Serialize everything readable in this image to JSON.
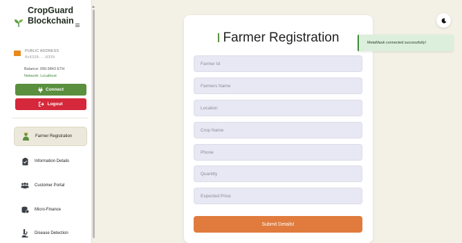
{
  "sidebar": {
    "brand": {
      "line1": "CropGuard",
      "line2": "Blockchain"
    },
    "account": {
      "address_label": "PUBLIC ADDRESS",
      "address_value": "0x6320...8339",
      "balance": "Balance: 999.9843 ETH",
      "network": "Network: Localhost"
    },
    "connect_label": "Connect",
    "logout_label": "Logout",
    "nav": [
      {
        "label": "Farmer Registration",
        "icon": "farmer-icon",
        "active": true
      },
      {
        "label": "Information Details",
        "icon": "clipboard-icon",
        "active": false
      },
      {
        "label": "Customer Portal",
        "icon": "users-icon",
        "active": false
      },
      {
        "label": "Micro-Finance",
        "icon": "coins-icon",
        "active": false
      },
      {
        "label": "Disease Detection",
        "icon": "microscope-icon",
        "active": false
      }
    ]
  },
  "form": {
    "title": "Farmer Registration",
    "fields": [
      {
        "placeholder": "Farmer Id",
        "value": ""
      },
      {
        "placeholder": "Farmers Name",
        "value": ""
      },
      {
        "placeholder": "Location",
        "value": ""
      },
      {
        "placeholder": "Crop Name",
        "value": ""
      },
      {
        "placeholder": "Phone",
        "value": ""
      },
      {
        "placeholder": "Quantity",
        "value": ""
      },
      {
        "placeholder": "Expected Price",
        "value": ""
      }
    ],
    "submit_label": "Submit Details!"
  },
  "toast": {
    "message": "MetaMask connected successfully!"
  },
  "colors": {
    "accent": "#5a8f3e",
    "danger": "#d5283a",
    "submit": "#e07b3d",
    "background": "#f3f0e6"
  }
}
